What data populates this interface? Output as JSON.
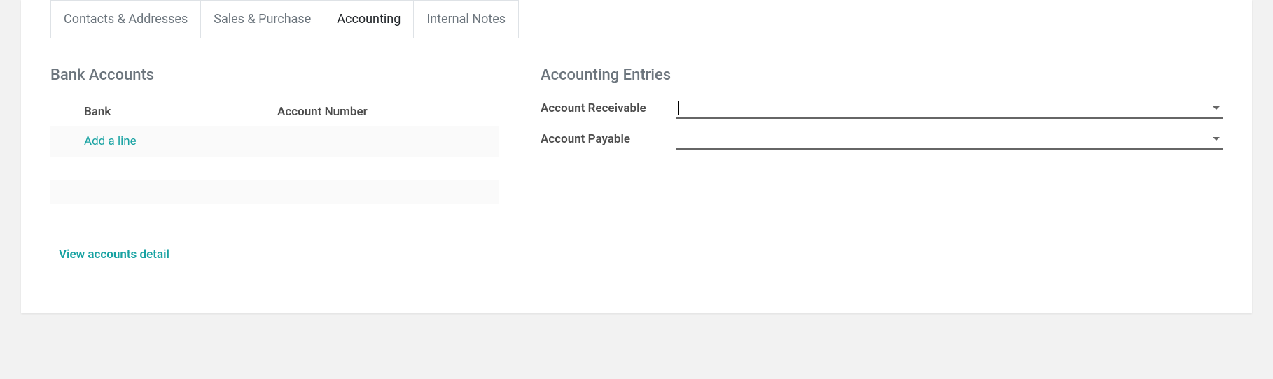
{
  "tabs": [
    {
      "label": "Contacts & Addresses",
      "active": false
    },
    {
      "label": "Sales & Purchase",
      "active": false
    },
    {
      "label": "Accounting",
      "active": true
    },
    {
      "label": "Internal Notes",
      "active": false
    }
  ],
  "bank_section": {
    "title": "Bank Accounts",
    "columns": {
      "bank": "Bank",
      "account_number": "Account Number"
    },
    "add_line": "Add a line",
    "view_detail": "View accounts detail"
  },
  "entries_section": {
    "title": "Accounting Entries",
    "fields": {
      "receivable": {
        "label": "Account Receivable",
        "value": ""
      },
      "payable": {
        "label": "Account Payable",
        "value": ""
      }
    }
  }
}
